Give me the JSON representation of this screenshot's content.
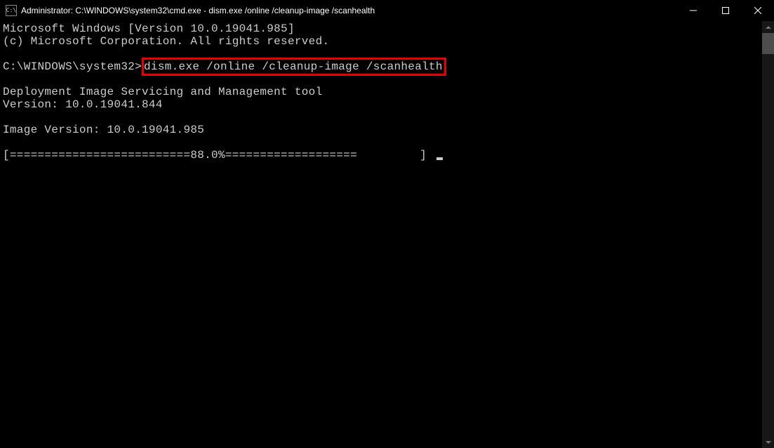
{
  "window": {
    "title": "Administrator: C:\\WINDOWS\\system32\\cmd.exe - dism.exe  /online /cleanup-image /scanhealth",
    "icon_label": "C:\\"
  },
  "terminal": {
    "line1": "Microsoft Windows [Version 10.0.19041.985]",
    "line2": "(c) Microsoft Corporation. All rights reserved.",
    "blank3": "",
    "prompt": "C:\\WINDOWS\\system32>",
    "command": "dism.exe /online /cleanup-image /scanhealth",
    "blank5": "",
    "line6": "Deployment Image Servicing and Management tool",
    "line7": "Version: 10.0.19041.844",
    "blank8": "",
    "line9": "Image Version: 10.0.19041.985",
    "blank10": "",
    "progress": "[==========================88.0%===================         ] "
  }
}
